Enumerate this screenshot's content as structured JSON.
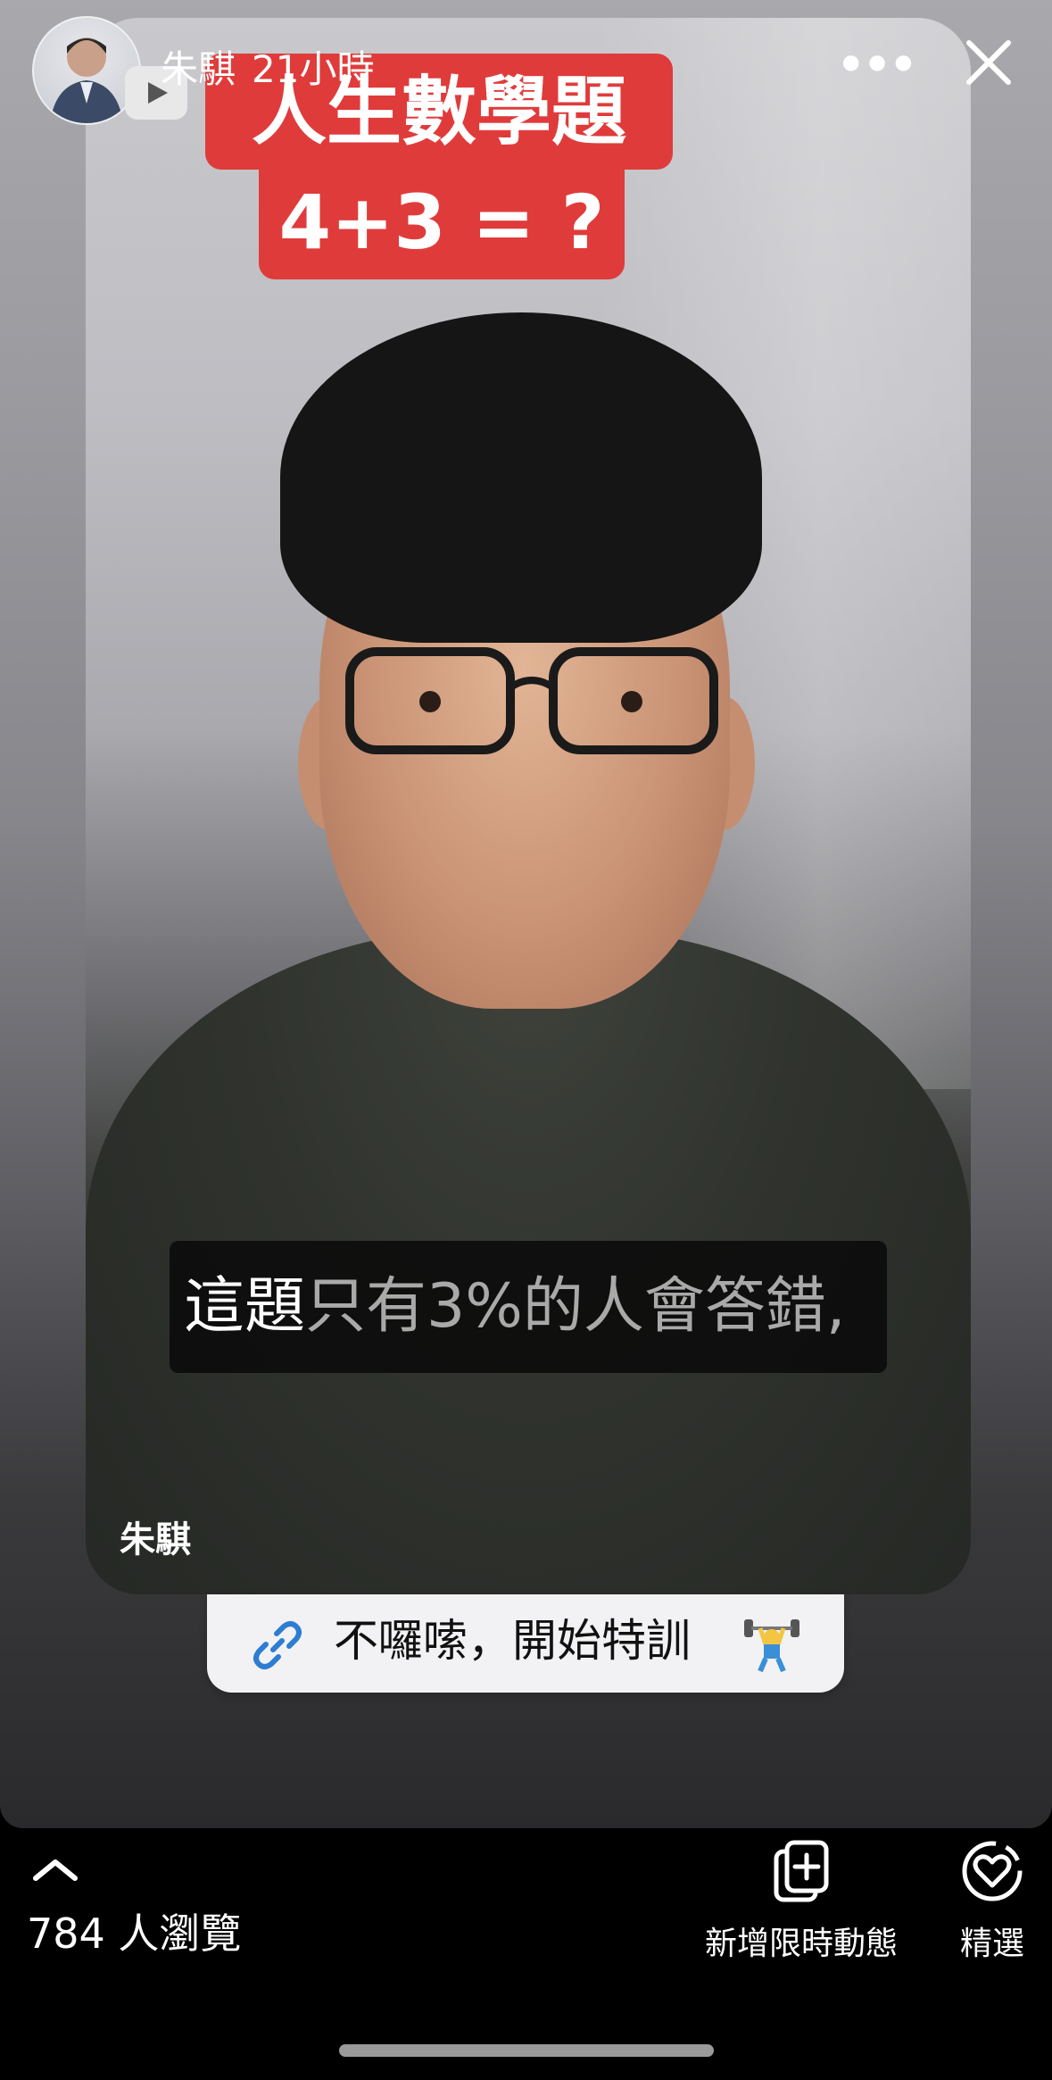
{
  "header": {
    "username": "朱騏",
    "time": "21小時",
    "more_label": "•••"
  },
  "story": {
    "title_line1": "人生數學題",
    "title_line2": "4+3 = ?",
    "subtitle_part1": "這題",
    "subtitle_part2": "只有3%的人會答錯,",
    "author_tag": "朱騏"
  },
  "link_sticker": {
    "text": "不囉嗦，開始特訓"
  },
  "footer": {
    "views": "784 人瀏覽",
    "add_story_label": "新增限時動態",
    "highlight_label": "精選"
  }
}
